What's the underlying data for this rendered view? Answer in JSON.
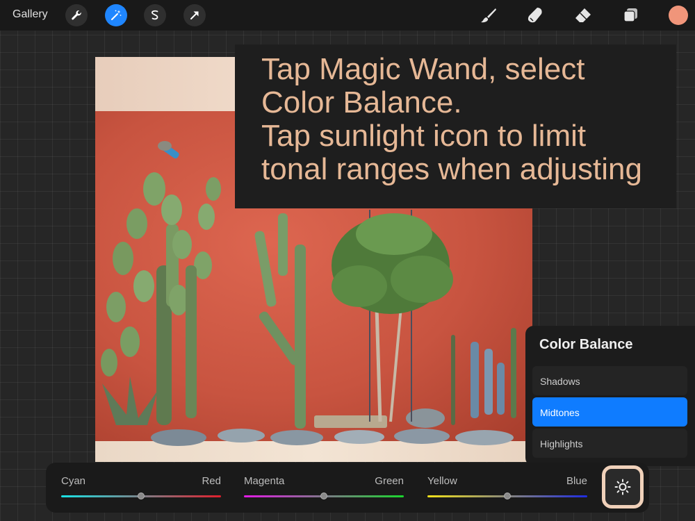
{
  "toolbar": {
    "gallery_label": "Gallery",
    "left_tools": [
      "wrench-icon",
      "magic-wand-icon",
      "selection-icon",
      "transform-arrow-icon"
    ],
    "active_tool": "magic-wand-icon",
    "right_tools": [
      "brush-icon",
      "smudge-icon",
      "eraser-icon",
      "layers-icon"
    ],
    "current_color": "#f0957a",
    "accent": "#1f86ff"
  },
  "instruction": {
    "line1": "Tap Magic Wand, select",
    "line2": "Color Balance.",
    "line3": "Tap sunlight icon to limit",
    "line4": "tonal ranges when adjusting",
    "color": "#e6b896"
  },
  "color_balance": {
    "title": "Color Balance",
    "options": [
      "Shadows",
      "Midtones",
      "Highlights"
    ],
    "selected": "Midtones"
  },
  "sliders": [
    {
      "left": "Cyan",
      "right": "Red",
      "value": 0.5
    },
    {
      "left": "Magenta",
      "right": "Green",
      "value": 0.5
    },
    {
      "left": "Yellow",
      "right": "Blue",
      "value": 0.5
    }
  ],
  "tonal_button_icon": "sun-icon"
}
